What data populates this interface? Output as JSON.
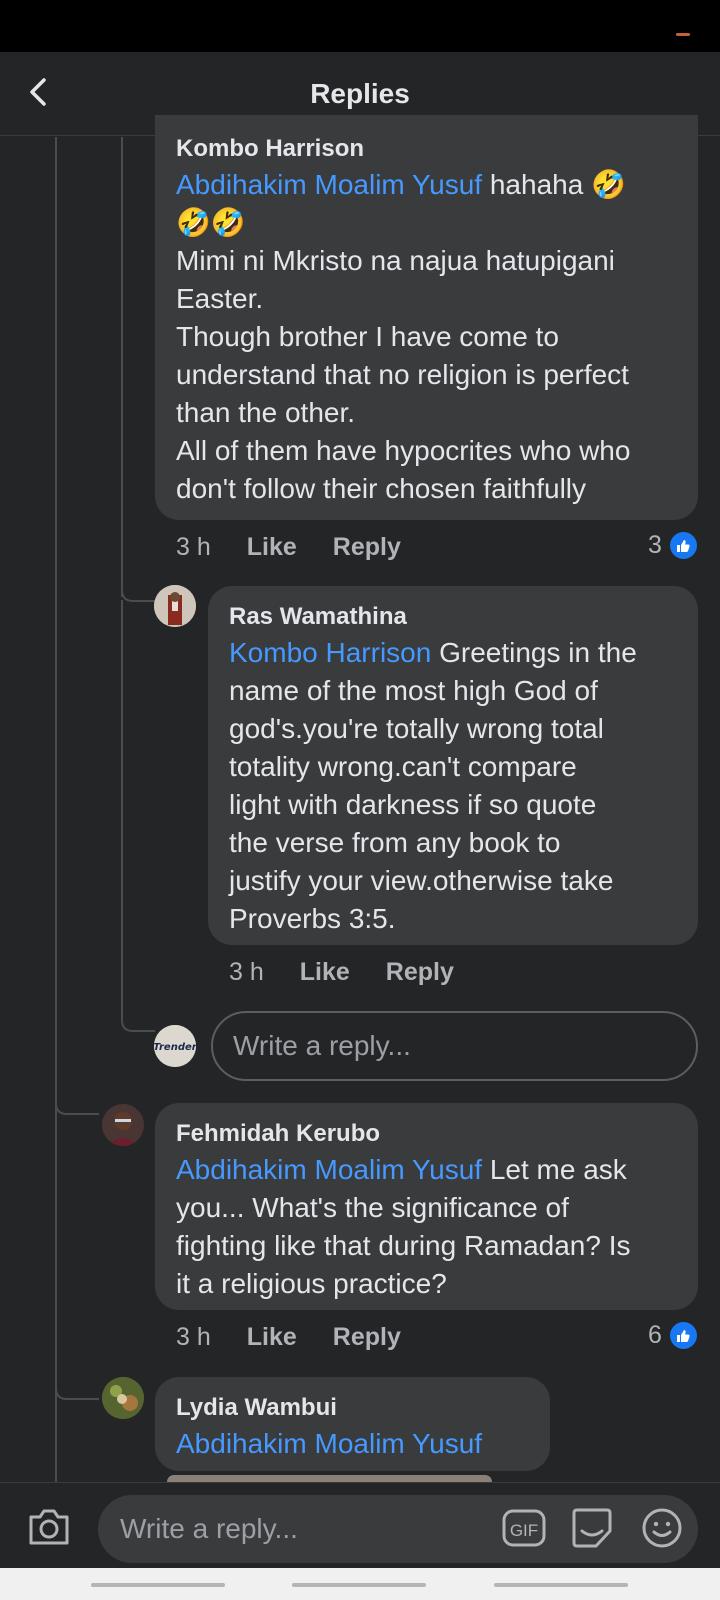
{
  "header": {
    "title": "Replies"
  },
  "comments": [
    {
      "author": "Kombo Harrison",
      "mention": "Abdihakim Moalim Yusuf",
      "text_after_mention": "  hahaha 🤣",
      "lines": [
        "🤣🤣",
        "Mimi ni Mkristo na najua hatupigani",
        "Easter.",
        "Though brother I have come to",
        "understand that no religion is perfect",
        "than the other.",
        "All of them have hypocrites who who",
        "don't  follow their chosen faithfully"
      ],
      "time": "3 h",
      "like_label": "Like",
      "reply_label": "Reply",
      "reaction_count": "3"
    },
    {
      "author": "Ras Wamathina",
      "mention": "Kombo Harrison",
      "text_after_mention": " Greetings in the",
      "lines": [
        "name of the most high God of",
        "god's.you're totally wrong total",
        "totality wrong.can't compare",
        "light with darkness if so quote",
        "the verse from any book to",
        "justify your view.otherwise take",
        "Proverbs 3:5."
      ],
      "time": "3 h",
      "like_label": "Like",
      "reply_label": "Reply"
    },
    {
      "author": "Fehmidah Kerubo",
      "mention": "Abdihakim Moalim Yusuf",
      "text_after_mention": " Let me ask",
      "lines": [
        "you... What's the significance of",
        "fighting like that during Ramadan? Is",
        "it a religious practice?"
      ],
      "time": "3 h",
      "like_label": "Like",
      "reply_label": "Reply",
      "reaction_count": "6"
    },
    {
      "author": "Lydia Wambui",
      "mention": "Abdihakim Moalim Yusuf"
    }
  ],
  "inline_reply": {
    "placeholder": "Write a reply...",
    "avatar_text": "Trender"
  },
  "composer": {
    "placeholder": "Write a reply...",
    "gif_label": "GIF"
  },
  "colors": {
    "background": "#242526",
    "bubble": "#3a3b3c",
    "mention": "#4599ff",
    "like_blue": "#1877f2"
  },
  "icons": [
    "back-arrow-icon",
    "camera-icon",
    "gif-icon",
    "sticker-icon",
    "emoji-icon",
    "like-thumb-icon"
  ]
}
